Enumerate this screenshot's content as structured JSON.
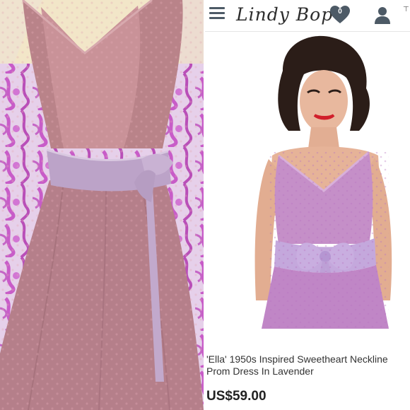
{
  "header": {
    "brand": "Lindy Bop",
    "wishlist_count": "0",
    "menu_icon": "hamburger-menu-icon",
    "wishlist_icon": "heart-icon",
    "account_icon": "user-icon"
  },
  "product": {
    "title_line1": "'Ella' 1950s Inspired Sweetheart Neckline",
    "title_line2": "Prom Dress In Lavender",
    "price": "US$59.00"
  },
  "colors": {
    "accent": "#4d5a66",
    "dress": "#c58fc8",
    "sash": "#c4a8dc"
  }
}
